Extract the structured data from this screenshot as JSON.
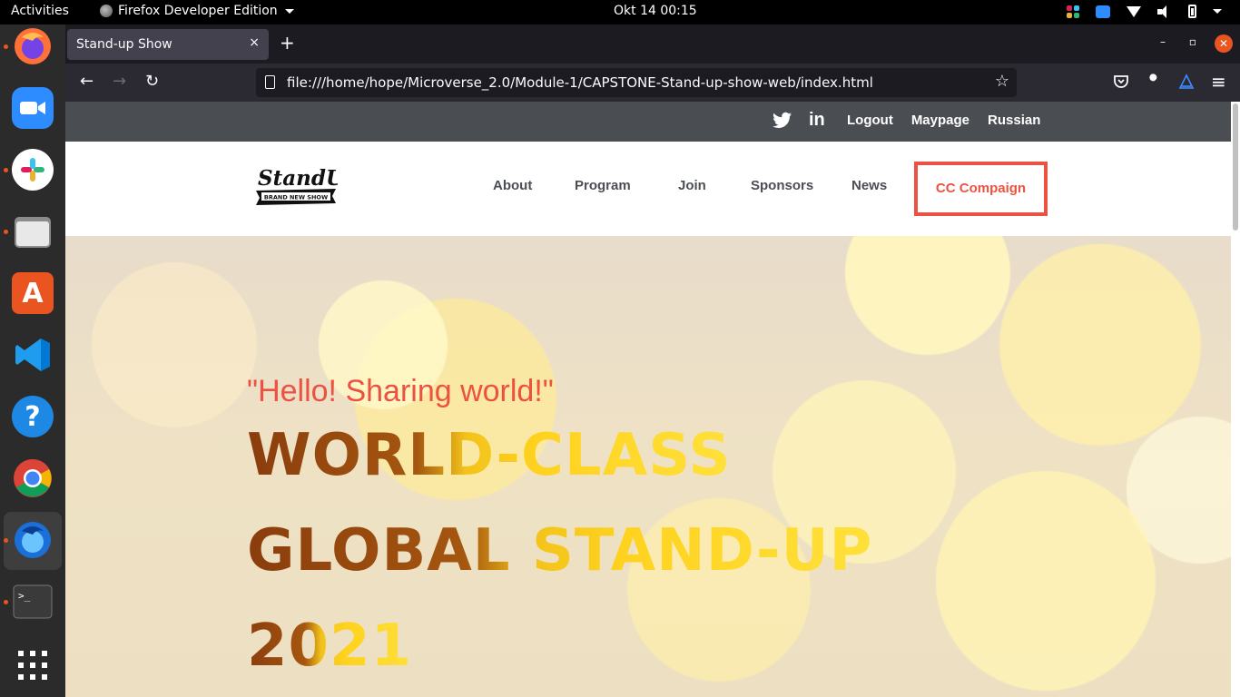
{
  "system": {
    "activities": "Activities",
    "app_name": "Firefox Developer Edition",
    "clock": "Okt 14  00:15"
  },
  "dock": {
    "items": [
      "firefox",
      "zoom",
      "slack",
      "files",
      "software",
      "vscode",
      "help",
      "chrome",
      "firefox-dev",
      "terminal",
      "show-apps"
    ]
  },
  "browser": {
    "tab_title": "Stand-up Show",
    "tab_close": "×",
    "new_tab": "+",
    "url": "file:///home/hope/Microverse_2.0/Module-1/CAPSTONE-Stand-up-show-web/index.html",
    "back": "←",
    "forward": "→",
    "reload": "↻",
    "star": "☆",
    "minimize": "–",
    "maximize": "▫",
    "close": "✕",
    "menu": "≡"
  },
  "site": {
    "social": {
      "twitter": "🐦",
      "linkedin": "in"
    },
    "top_links": [
      "Logout",
      "Maypage",
      "Russian"
    ],
    "logo": {
      "line1": "StandUp",
      "line2": "BRAND NEW SHOW"
    },
    "nav": [
      "About",
      "Program",
      "Join",
      "Sponsors",
      "News"
    ],
    "cta": "CC Compaign",
    "hero": {
      "tagline": "\"Hello! Sharing world!\"",
      "line1": "WORLD-CLASS",
      "line2": "GLOBAL STAND-UP",
      "line3": "2021"
    }
  },
  "colors": {
    "accent": "#ec5242",
    "site_topbar": "#4a4d52",
    "nav_text": "#4b4e54",
    "ubuntu_orange": "#e95420"
  }
}
